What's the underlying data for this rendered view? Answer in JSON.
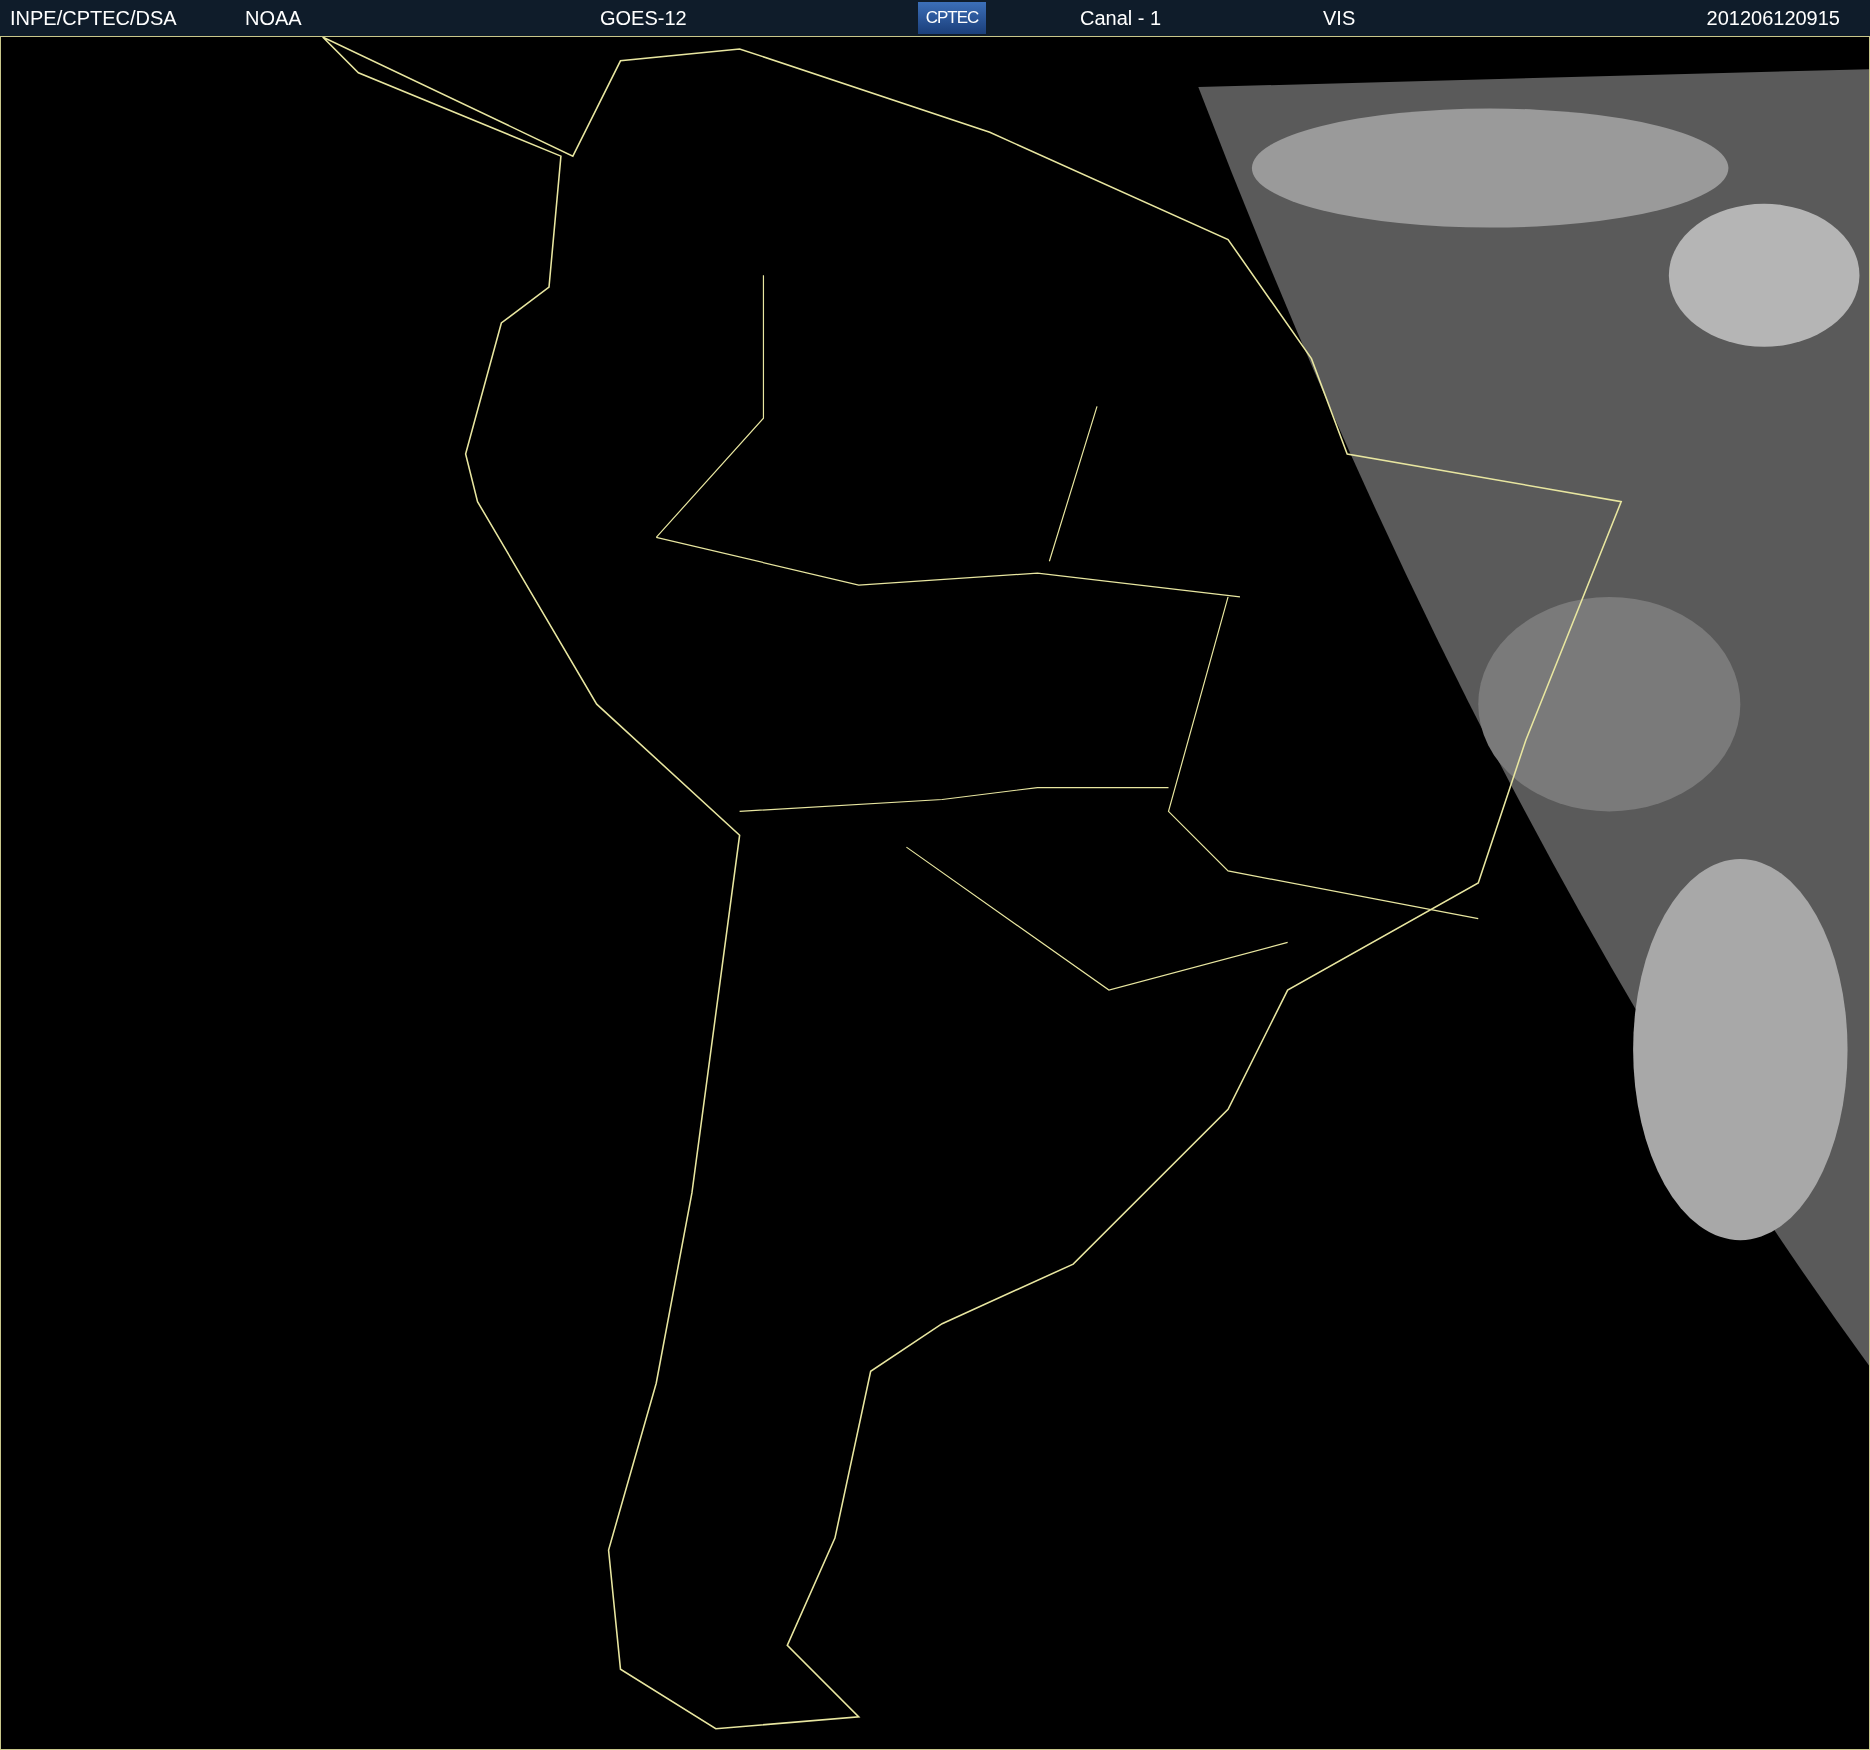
{
  "header": {
    "source": "INPE/CPTEC/DSA",
    "agency": "NOAA",
    "satellite": "GOES-12",
    "logo": "CPTEC",
    "channel": "Canal - 1",
    "band": "VIS",
    "timestamp": "201206120915"
  }
}
